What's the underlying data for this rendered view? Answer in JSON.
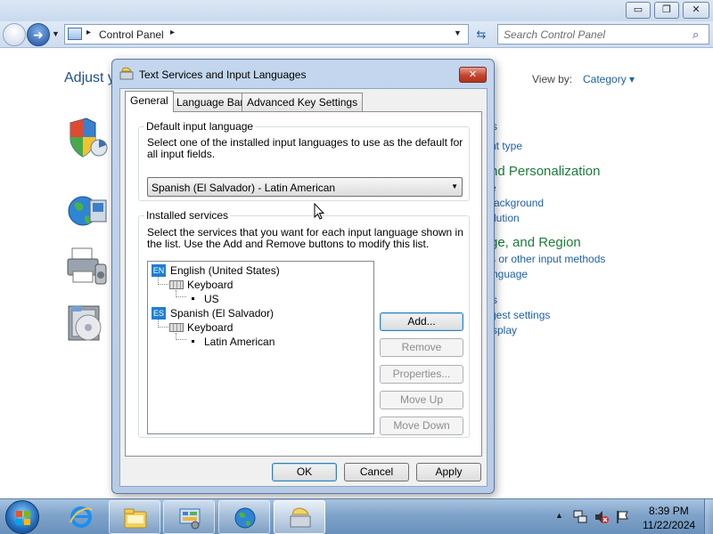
{
  "control_panel": {
    "window_controls": {
      "minimize": "▭",
      "maximize": "❐",
      "close": "✕"
    },
    "nav": {
      "back_icon": "back-arrow-icon",
      "forward_icon": "forward-arrow-icon",
      "forward_glyph": "➜",
      "history_dropdown": "▼"
    },
    "address": {
      "sep1": "▸",
      "location": "Control Panel",
      "sep2": "▸",
      "dropdown": "▼"
    },
    "refresh_glyph": "⇆",
    "search": {
      "placeholder": "Search Control Panel",
      "icon_glyph": "⌕"
    },
    "header_partial": "Adjust y",
    "view_by": {
      "label": "View by:",
      "value": "Category ▾"
    },
    "right_column": {
      "link_a": "s",
      "link_b": "nt type",
      "heading_appearance": "nd Personalization",
      "link_c": "e",
      "link_d": "ackground",
      "link_e": "lution",
      "heading_clock": "ge, and Region",
      "link_f": "s or other input methods",
      "link_g": "nguage",
      "link_h": "s",
      "link_i": "gest settings",
      "link_j": "splay"
    }
  },
  "dialog": {
    "title": "Text Services and Input Languages",
    "close_glyph": "✕",
    "tabs": [
      "General",
      "Language Bar",
      "Advanced Key Settings"
    ],
    "default_input": {
      "group_label": "Default input language",
      "description": "Select one of the installed input languages to use as the default for all input fields.",
      "selected_language": "Spanish (El Salvador) - Latin American",
      "dropdown_arrow": "▼"
    },
    "installed_services": {
      "group_label": "Installed services",
      "description": "Select the services that you want for each input language shown in the list. Use the Add and Remove buttons to modify this list.",
      "languages": [
        {
          "badge": "EN",
          "name": "English (United States)",
          "category": "Keyboard",
          "layout": "US"
        },
        {
          "badge": "ES",
          "name": "Spanish (El Salvador)",
          "category": "Keyboard",
          "layout": "Latin American"
        }
      ],
      "buttons": {
        "add": "Add...",
        "remove": "Remove",
        "properties": "Properties...",
        "move_up": "Move Up",
        "move_down": "Move Down"
      }
    },
    "footer_buttons": {
      "ok": "OK",
      "cancel": "Cancel",
      "apply": "Apply"
    }
  },
  "taskbar": {
    "pinned": [
      "internet-explorer-icon",
      "file-explorer-icon",
      "control-panel-icon",
      "network-globe-icon",
      "text-services-icon"
    ],
    "tray": {
      "show_hidden": "▲",
      "clock_time": "8:39 PM",
      "clock_date": "11/22/2024"
    }
  }
}
